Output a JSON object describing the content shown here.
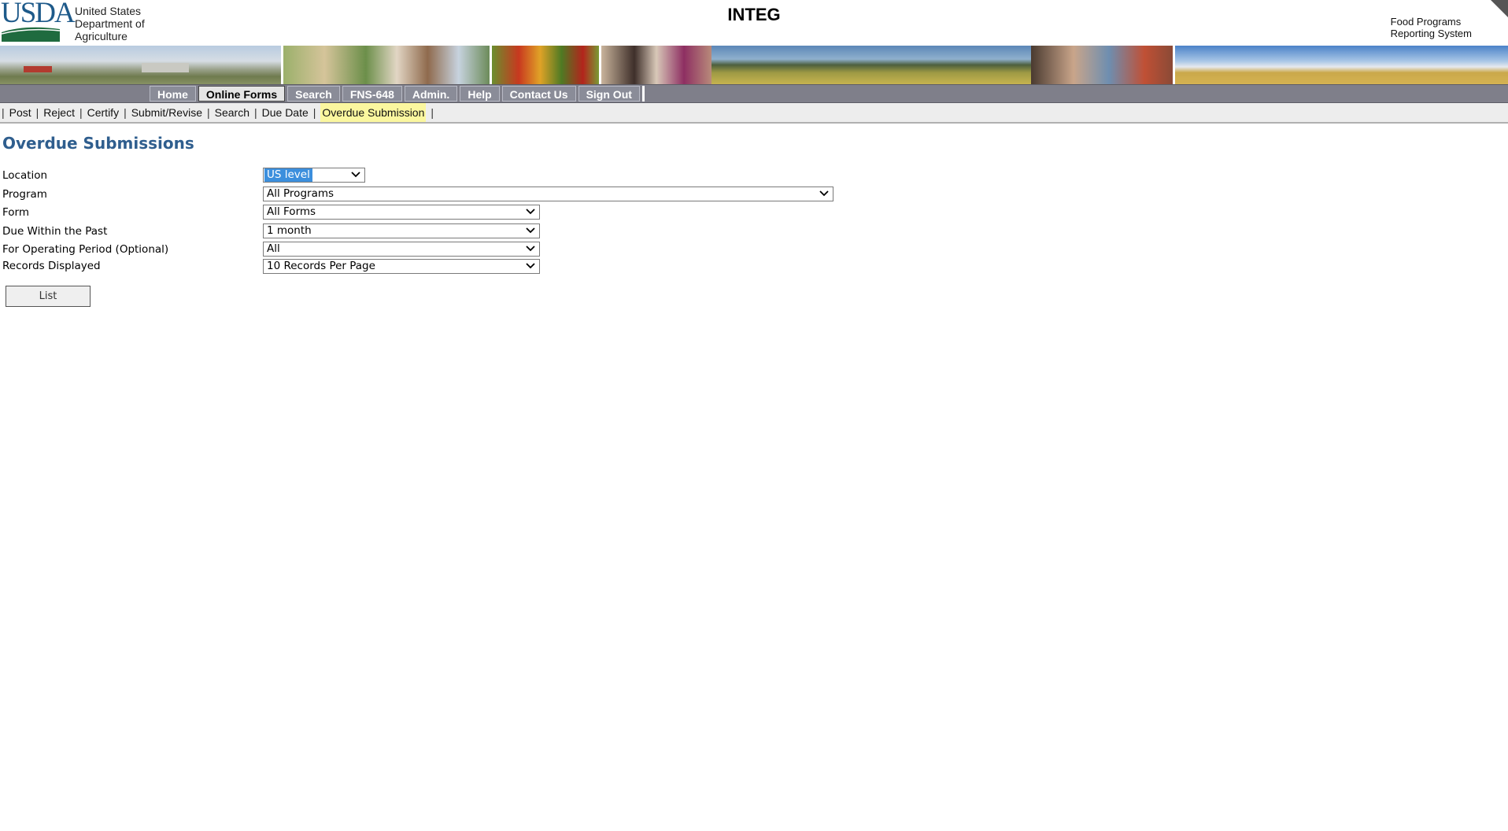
{
  "header": {
    "logo_mark": "USDA",
    "agency_lines": [
      "United States",
      "Department of",
      "Agriculture"
    ],
    "app_title": "INTEG",
    "system_name_lines": [
      "Food Programs",
      "Reporting System"
    ]
  },
  "nav": {
    "items": [
      {
        "label": "Home"
      },
      {
        "label": "Online Forms",
        "active": true
      },
      {
        "label": "Search"
      },
      {
        "label": "FNS-648"
      },
      {
        "label": "Admin."
      },
      {
        "label": "Help"
      },
      {
        "label": "Contact Us"
      },
      {
        "label": "Sign Out"
      }
    ]
  },
  "subnav": {
    "items": [
      {
        "label": "Post"
      },
      {
        "label": "Reject"
      },
      {
        "label": "Certify"
      },
      {
        "label": "Submit/Revise"
      },
      {
        "label": "Search"
      },
      {
        "label": "Due Date"
      },
      {
        "label": "Overdue Submission",
        "current": true
      }
    ]
  },
  "page": {
    "title": "Overdue Submissions"
  },
  "form": {
    "location": {
      "label": "Location",
      "value": "US level"
    },
    "program": {
      "label": "Program",
      "value": "All Programs"
    },
    "form_type": {
      "label": "Form",
      "value": "All Forms"
    },
    "due_within": {
      "label": "Due Within the Past",
      "value": "1 month"
    },
    "operating_period": {
      "label": "For Operating Period (Optional)",
      "value": "All"
    },
    "records": {
      "label": "Records Displayed",
      "value": "10 Records Per Page"
    },
    "list_button": "List"
  },
  "colors": {
    "title_blue": "#2f5e8e",
    "nav_bg": "#7f7f8a",
    "current_highlight": "#fbf79f",
    "select_highlight": "#3c8fdd"
  }
}
